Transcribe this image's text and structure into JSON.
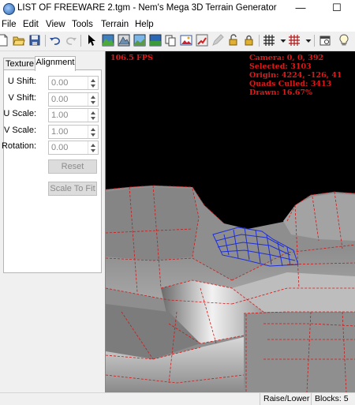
{
  "window": {
    "title": "LIST OF FREEWARE 2.tgm - Nem's Mega 3D Terrain Generator",
    "minimize_glyph": "—",
    "maximize_glyph": "☐"
  },
  "menu": [
    "File",
    "Edit",
    "View",
    "Tools",
    "Terrain",
    "Help"
  ],
  "toolbar": {
    "icons": [
      "new-file-icon",
      "open-folder-icon",
      "save-icon",
      "undo-icon",
      "redo-icon",
      "select-arrow-icon",
      "terrain-view-1-icon",
      "terrain-view-2-icon",
      "terrain-view-3-icon",
      "terrain-view-4-icon",
      "copy-icon",
      "image-icon",
      "paint-icon",
      "lock-open-icon",
      "lock-closed-icon",
      "grid-icon",
      "grid-dropdown-icon",
      "red-grid-icon",
      "red-grid-dropdown-icon",
      "properties-icon",
      "lightbulb-icon"
    ]
  },
  "panel": {
    "tabs": [
      "Texture",
      "Alignment"
    ],
    "active_tab": "Alignment",
    "fields": [
      {
        "label": "U Shift:",
        "value": "0.00"
      },
      {
        "label": "V Shift:",
        "value": "0.00"
      },
      {
        "label": "U Scale:",
        "value": "1.00"
      },
      {
        "label": "V Scale:",
        "value": "1.00"
      },
      {
        "label": "Rotation:",
        "value": "0.00"
      }
    ],
    "reset_label": "Reset",
    "scale_to_fit_label": "Scale To Fit"
  },
  "viewport": {
    "fps": "106.5 FPS",
    "camera": "Camera: 0, 0, 392",
    "selected": "Selected: 3103",
    "origin": "Origin: 4224, -126, 41",
    "quads_culled": "Quads Culled: 3413",
    "drawn": "Drawn: 16.67%",
    "overlay_color": "#e01818",
    "selection_color": "#1f2fd6"
  },
  "status": {
    "mode": "Raise/Lower",
    "blocks": "Blocks: 5"
  }
}
